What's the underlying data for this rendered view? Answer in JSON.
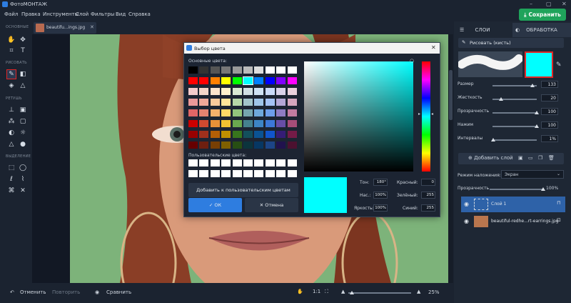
{
  "app": {
    "title": "ФотоМОНТАЖ"
  },
  "menu": [
    "Файл",
    "Правка",
    "Инструменты",
    "Слой",
    "Фильтры",
    "Вид",
    "Справка"
  ],
  "save_label": "Сохранить",
  "toolbar": {
    "basic": "ОСНОВНЫЕ",
    "draw": "РИСОВАТЬ",
    "retouch": "РЕТУШЬ",
    "select": "ВЫДЕЛЕНИЕ"
  },
  "doc_tab": {
    "name": "beautifu...ings.jpg"
  },
  "bottom": {
    "undo": "Отменить",
    "redo": "Повторить",
    "compare": "Сравнить",
    "ratio": "1:1",
    "zoom": "25%"
  },
  "right": {
    "tabs": [
      "СЛОИ",
      "ОБРАБОТКА"
    ],
    "brush": "Рисовать (кисть)",
    "brush_color": "#00ffff",
    "params": [
      {
        "label": "Размер",
        "value": "133",
        "level": 0.9
      },
      {
        "label": "Жесткость",
        "value": "20",
        "level": 0.2
      },
      {
        "label": "Прозрачность",
        "value": "100",
        "level": 1.0
      },
      {
        "label": "Нажим",
        "value": "100",
        "level": 1.0
      },
      {
        "label": "Интервалы",
        "value": "1%",
        "level": 0.01
      }
    ],
    "add_layer": "Добавить слой",
    "blend_label": "Режим наложения:",
    "blend_value": "Экран",
    "opacity_label": "Прозрачность",
    "opacity_value": "100%",
    "layers": [
      "Слой 1",
      "beautiful-redhe...rt-earrings.jpg"
    ]
  },
  "dialog": {
    "title": "Выбор цвета",
    "basic_colors": "Основные цвета:",
    "custom_colors": "Пользовательские цвета:",
    "add_custom": "Добавить к пользовательским цветам",
    "ok": "ОК",
    "cancel": "Отмена",
    "hue_label": "Тон:",
    "hue": "180°",
    "sat_label": "Нас.:",
    "sat": "100%",
    "val_label": "Яркость:",
    "val": "100%",
    "red_label": "Красный:",
    "red": "0",
    "green_label": "Зелёный:",
    "green": "255",
    "blue_label": "Синий:",
    "blue": "255",
    "current_color": "#00ffff",
    "palette": [
      "#000000",
      "#333333",
      "#555555",
      "#777777",
      "#999999",
      "#bbbbbb",
      "#dddddd",
      "#ffffff",
      "#ffffff",
      "#ffffff",
      "#ff0000",
      "#ff0000",
      "#ff8000",
      "#ffff00",
      "#00ff00",
      "#00ffff",
      "#0080ff",
      "#0000ff",
      "#8000ff",
      "#ff00ff",
      "#f4cccc",
      "#f4d5c8",
      "#fce5cd",
      "#fff2cc",
      "#d9ead3",
      "#d0e0e3",
      "#cfe2f3",
      "#c9daf8",
      "#d9d2e9",
      "#ead1dc",
      "#ea9999",
      "#f0a898",
      "#f9cb9c",
      "#ffe599",
      "#b6d7a8",
      "#a2c4c9",
      "#9fc5e8",
      "#a4c2f4",
      "#b4a7d6",
      "#d5a6bd",
      "#e06666",
      "#e58370",
      "#f6b26b",
      "#ffd966",
      "#93c47d",
      "#76a5af",
      "#6fa8dc",
      "#6d9eeb",
      "#8e7cc3",
      "#c27ba0",
      "#cc0000",
      "#d04a30",
      "#e69138",
      "#f1c232",
      "#6aa84f",
      "#45818e",
      "#3d85c6",
      "#3c78d8",
      "#674ea7",
      "#a64d79",
      "#990000",
      "#a0301c",
      "#b45f06",
      "#bf9000",
      "#38761d",
      "#134f5c",
      "#0b5394",
      "#1155cc",
      "#351c75",
      "#741b47",
      "#660000",
      "#6e1f10",
      "#783f04",
      "#7f6000",
      "#274e13",
      "#0c343d",
      "#073763",
      "#1c4587",
      "#20124d",
      "#4c1130"
    ]
  }
}
